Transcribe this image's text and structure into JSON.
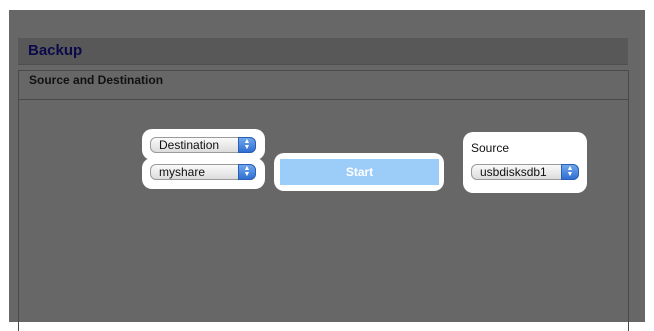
{
  "panel": {
    "title": "Backup"
  },
  "section": {
    "title": "Source and Destination"
  },
  "destination": {
    "type_select": "Destination",
    "share_select": "myshare"
  },
  "start": {
    "label": "Start"
  },
  "source": {
    "label": "Source",
    "disk_select": "usbdisksdb1"
  }
}
